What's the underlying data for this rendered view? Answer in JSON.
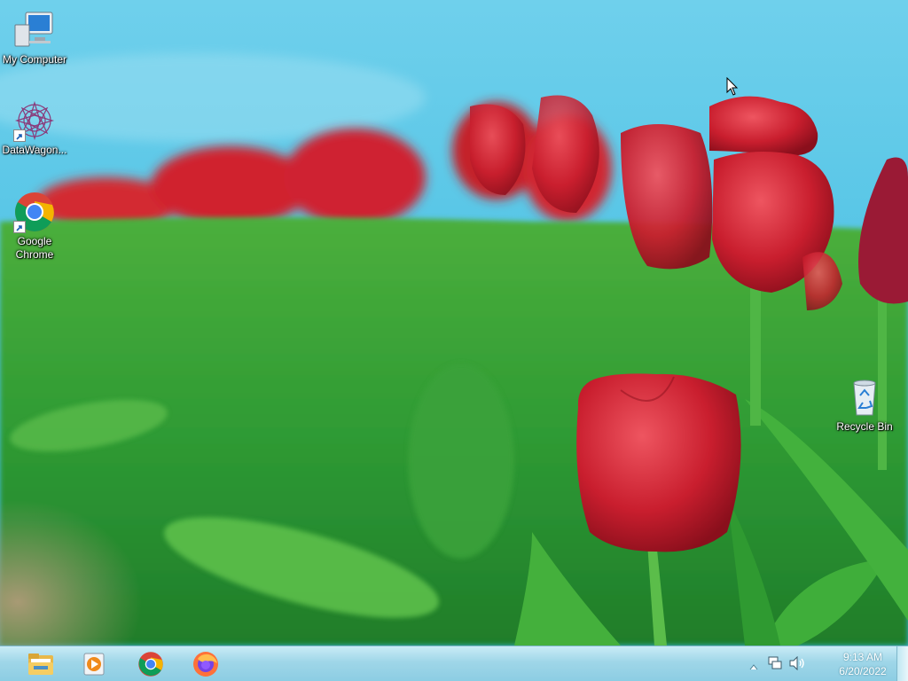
{
  "desktop": {
    "icons": [
      {
        "label": "My Computer",
        "icon": "computer-icon"
      },
      {
        "label": "DataWagon...",
        "icon": "datawagon-icon"
      },
      {
        "label": "Google Chrome",
        "icon": "chrome-icon"
      },
      {
        "label": "Recycle Bin",
        "icon": "recycle-bin-icon"
      }
    ]
  },
  "taskbar": {
    "pinned": [
      {
        "name": "File Explorer",
        "icon": "folder-icon"
      },
      {
        "name": "Windows Media Player",
        "icon": "media-player-icon"
      },
      {
        "name": "Google Chrome",
        "icon": "chrome-icon"
      },
      {
        "name": "Firefox",
        "icon": "firefox-icon"
      }
    ],
    "tray": {
      "icons": [
        "show-hidden-icons-arrow-icon",
        "network-icon",
        "volume-icon"
      ]
    },
    "clock": {
      "time": "9:13 AM",
      "date": "6/20/2022"
    }
  },
  "colors": {
    "sky": "#5cc8e6",
    "tulip_red": "#c8202e",
    "leaf_green": "#3fa83a",
    "taskbar": "#9fd6e8"
  }
}
